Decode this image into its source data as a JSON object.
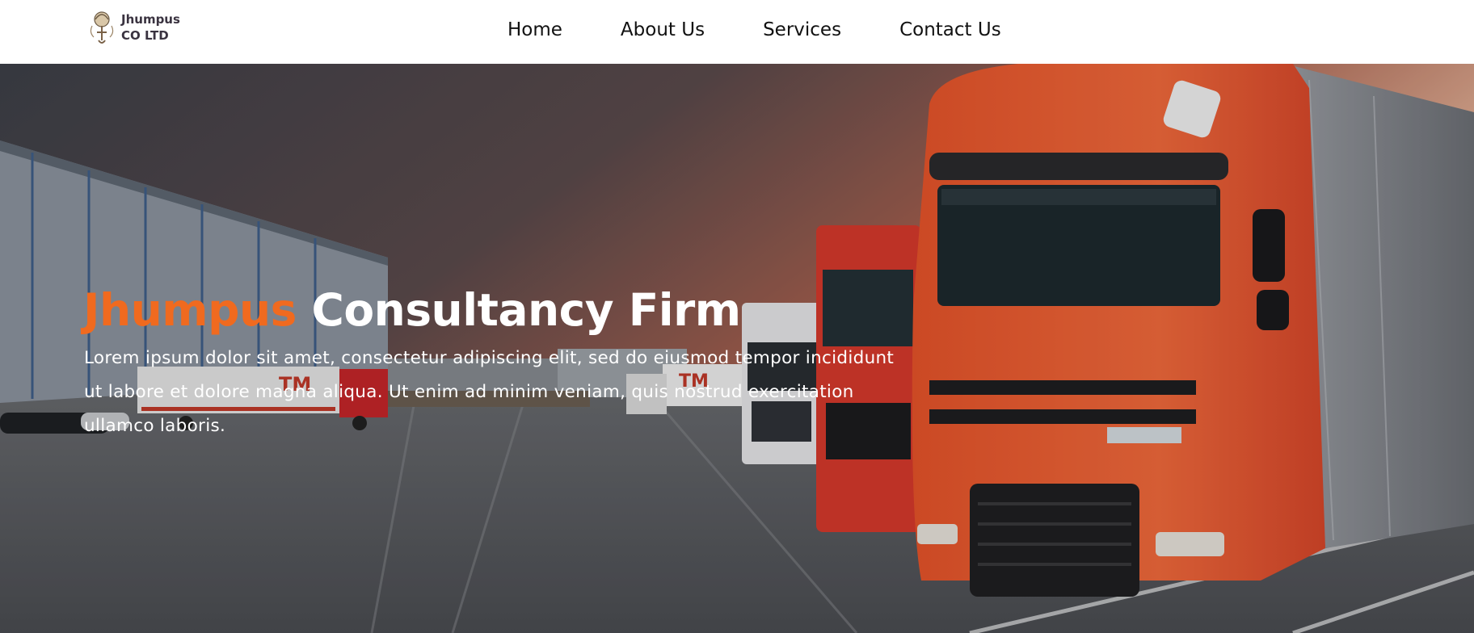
{
  "brand": {
    "line1": "Jhumpus",
    "line2": "CO LTD"
  },
  "nav": [
    {
      "label": "Home"
    },
    {
      "label": "About Us"
    },
    {
      "label": "Services"
    },
    {
      "label": "Contact Us"
    }
  ],
  "hero": {
    "title_accent": "Jhumpus",
    "title_rest": "Consultancy Firm",
    "description_lines": [
      "Lorem ipsum dolor sit amet, consectetur adipiscing elit, sed do eiusmod tempor incididunt",
      "ut labore et dolore magna aliqua. Ut enim ad minim veniam, quis nostrud exercitation",
      "ullamco laboris."
    ],
    "truck_logo_text": "TM",
    "accent_color": "#f06a1f"
  }
}
